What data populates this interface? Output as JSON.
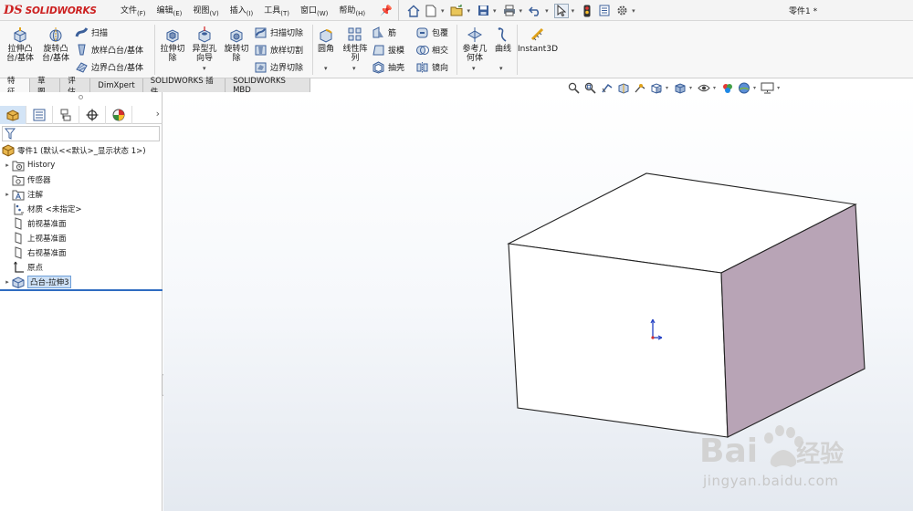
{
  "app": {
    "logo_symbol": "DS",
    "logo_text": "SOLIDWORKS",
    "doc_title": "零件1 *"
  },
  "menus": [
    {
      "label": "文件",
      "key": "(F)"
    },
    {
      "label": "编辑",
      "key": "(E)"
    },
    {
      "label": "视图",
      "key": "(V)"
    },
    {
      "label": "插入",
      "key": "(I)"
    },
    {
      "label": "工具",
      "key": "(T)"
    },
    {
      "label": "窗口",
      "key": "(W)"
    },
    {
      "label": "帮助",
      "key": "(H)"
    }
  ],
  "commands": {
    "extrude_boss_l1": "拉伸凸",
    "extrude_boss_l2": "台/基体",
    "revolve_boss_l1": "旋转凸",
    "revolve_boss_l2": "台/基体",
    "sweep": "扫描",
    "loft": "放样凸台/基体",
    "boundary": "边界凸台/基体",
    "extrude_cut_l1": "拉伸切",
    "extrude_cut_l2": "除",
    "hole_wizard_l1": "异型孔",
    "hole_wizard_l2": "向导",
    "revolve_cut_l1": "旋转切",
    "revolve_cut_l2": "除",
    "swept_cut": "扫描切除",
    "lofted_cut": "放样切割",
    "boundary_cut": "边界切除",
    "fillet": "圆角",
    "linear_pattern_l1": "线性阵",
    "linear_pattern_l2": "列",
    "rib": "筋",
    "draft": "拔模",
    "shell": "抽壳",
    "wrap": "包覆",
    "intersect": "相交",
    "mirror": "镜向",
    "ref_geometry_l1": "参考几",
    "ref_geometry_l2": "何体",
    "curves": "曲线",
    "instant3d": "Instant3D"
  },
  "tabs": [
    "特征",
    "草图",
    "评估",
    "DimXpert",
    "SOLIDWORKS 插件",
    "SOLIDWORKS MBD"
  ],
  "tree": {
    "root": "零件1  (默认<<默认>_显示状态 1>)",
    "items": [
      {
        "label": "History",
        "icon": "history-folder-icon",
        "expandable": true
      },
      {
        "label": "传感器",
        "icon": "sensor-icon",
        "expandable": false
      },
      {
        "label": "注解",
        "icon": "annotation-icon",
        "expandable": true
      },
      {
        "label": "材质 <未指定>",
        "icon": "material-icon",
        "expandable": false
      },
      {
        "label": "前视基准面",
        "icon": "plane-icon",
        "expandable": false
      },
      {
        "label": "上视基准面",
        "icon": "plane-icon",
        "expandable": false
      },
      {
        "label": "右视基准面",
        "icon": "plane-icon",
        "expandable": false
      },
      {
        "label": "原点",
        "icon": "origin-icon",
        "expandable": false
      },
      {
        "label": "凸台-拉伸3",
        "icon": "extrude-feature-icon",
        "expandable": true,
        "selected": true
      }
    ]
  },
  "watermark": {
    "brand": "Bai",
    "suffix": "经验",
    "url": "jingyan.baidu.com"
  },
  "colors": {
    "logo_red": "#cc1f1f",
    "cube_front": "#ffffff",
    "cube_right": "#b8a4b6",
    "selection": "#cde0f5",
    "accent_blue": "#2f6cc1"
  }
}
